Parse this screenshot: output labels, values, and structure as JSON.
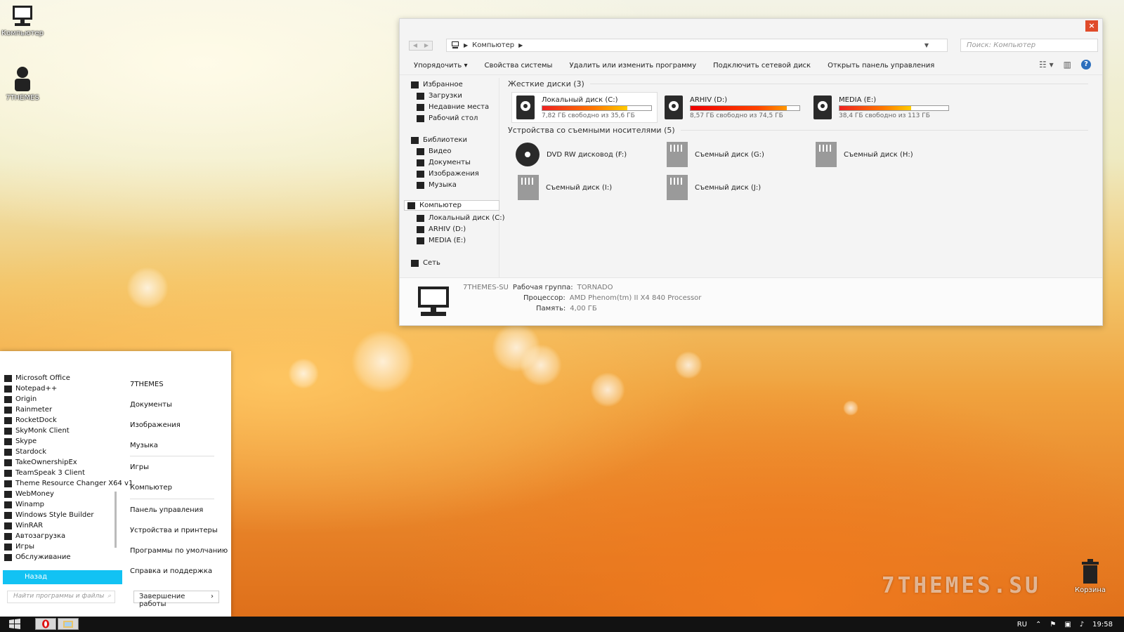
{
  "desktop": {
    "icons": [
      {
        "label": "Компьютер",
        "icon": "computer-icon"
      },
      {
        "label": "7THEMES",
        "icon": "user-icon"
      }
    ],
    "trash_label": "Корзина",
    "watermark": "7THEMES.SU"
  },
  "explorer": {
    "close_glyph": "×",
    "address": {
      "root_label": "Компьютер",
      "icon": "computer-icon"
    },
    "search_placeholder": "Поиск: Компьютер",
    "toolbar": {
      "organize": "Упорядочить",
      "system_properties": "Свойства системы",
      "uninstall": "Удалить или изменить программу",
      "map_drive": "Подключить сетевой диск",
      "control_panel": "Открыть панель управления"
    },
    "nav": {
      "favorites": "Избранное",
      "downloads": "Загрузки",
      "recent": "Недавние места",
      "desktop": "Рабочий стол",
      "libraries": "Библиотеки",
      "video": "Видео",
      "documents": "Документы",
      "images": "Изображения",
      "music": "Музыка",
      "computer": "Компьютер",
      "drive_c": "Локальный диск (C:)",
      "drive_d": "ARHIV (D:)",
      "drive_e": "MEDIA (E:)",
      "network": "Сеть"
    },
    "hard_drives": {
      "heading": "Жесткие диски (3)",
      "drives": [
        {
          "name": "Локальный диск (C:)",
          "free_text": "7,82 ГБ свободно из 35,6 ГБ",
          "used_fraction": 0.78
        },
        {
          "name": "ARHIV (D:)",
          "free_text": "8,57 ГБ свободно из 74,5 ГБ",
          "used_fraction": 0.885
        },
        {
          "name": "MEDIA (E:)",
          "free_text": "38,4 ГБ свободно из 113 ГБ",
          "used_fraction": 0.66
        }
      ]
    },
    "removable": {
      "heading": "Устройства со съемными носителями (5)",
      "devices": [
        {
          "name": "DVD RW дисковод (F:)",
          "icon": "dvd-icon"
        },
        {
          "name": "Съемный диск (G:)",
          "icon": "sd-card-icon"
        },
        {
          "name": "Съемный диск (H:)",
          "icon": "sd-card-icon"
        },
        {
          "name": "Съемный диск (I:)",
          "icon": "sd-card-icon"
        },
        {
          "name": "Съемный диск (J:)",
          "icon": "sd-card-icon"
        }
      ]
    },
    "details": {
      "computer_name": "7THEMES-SU",
      "workgroup_label": "Рабочая группа:",
      "workgroup_value": "TORNADO",
      "cpu_label": "Процессор:",
      "cpu_value": "AMD Phenom(tm) II X4 840 Processor",
      "mem_label": "Память:",
      "mem_value": "4,00 ГБ"
    }
  },
  "start_menu": {
    "programs": [
      "Microsoft Office",
      "Notepad++",
      "Origin",
      "Rainmeter",
      "RocketDock",
      "SkyMonk Client",
      "Skype",
      "Stardock",
      "TakeOwnershipEx",
      "TeamSpeak 3 Client",
      "Theme Resource Changer X64 v1",
      "WebMoney",
      "Winamp",
      "Windows Style Builder",
      "WinRAR",
      "Автозагрузка",
      "Игры",
      "Обслуживание"
    ],
    "back": "Назад",
    "search_placeholder": "Найти программы и файлы",
    "right": {
      "user": "7THEMES",
      "documents": "Документы",
      "images": "Изображения",
      "music": "Музыка",
      "games": "Игры",
      "computer": "Компьютер",
      "control_panel": "Панель управления",
      "devices": "Устройства и принтеры",
      "defaults": "Программы по умолчанию",
      "help": "Справка и поддержка"
    },
    "shutdown": "Завершение работы",
    "shutdown_arrow": "›"
  },
  "taskbar": {
    "lang": "RU",
    "time": "19:58",
    "pinned": [
      "opera-icon",
      "explorer-icon"
    ]
  }
}
